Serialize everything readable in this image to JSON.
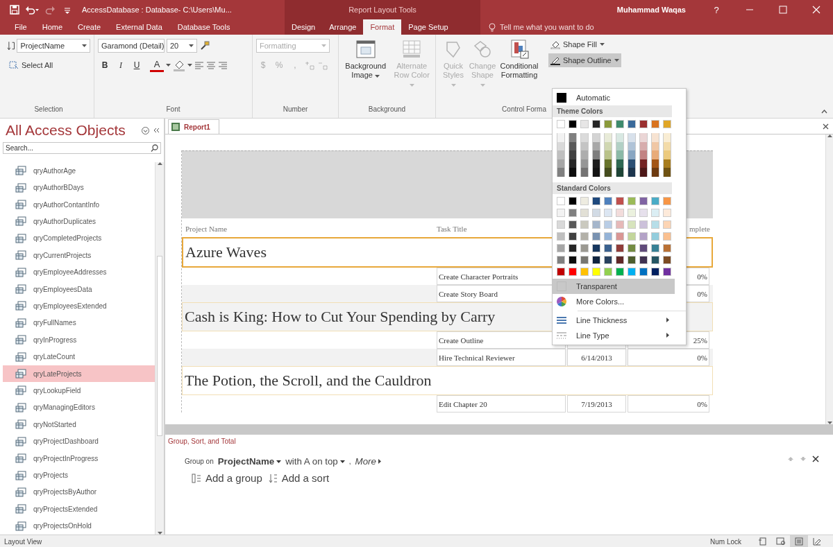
{
  "window": {
    "title": "AccessDatabase : Database- C:\\Users\\Mu...",
    "context_label": "Report Layout Tools",
    "user": "Muhammad Waqas",
    "help": "?"
  },
  "tabs": [
    {
      "label": "File",
      "selected": false,
      "contextual": false
    },
    {
      "label": "Home",
      "selected": false,
      "contextual": false
    },
    {
      "label": "Create",
      "selected": false,
      "contextual": false
    },
    {
      "label": "External Data",
      "selected": false,
      "contextual": false
    },
    {
      "label": "Database Tools",
      "selected": false,
      "contextual": false
    },
    {
      "label": "Design",
      "selected": false,
      "contextual": true
    },
    {
      "label": "Arrange",
      "selected": false,
      "contextual": true
    },
    {
      "label": "Format",
      "selected": true,
      "contextual": true
    },
    {
      "label": "Page Setup",
      "selected": false,
      "contextual": true
    }
  ],
  "tell_me": "Tell me what you want to do",
  "ribbon": {
    "selection": {
      "label": "Selection",
      "field": "ProjectName",
      "select_all": "Select All"
    },
    "font": {
      "label": "Font",
      "family": "Garamond (Detail)",
      "size": "20",
      "styles": [
        {
          "kind": "bold",
          "label": "B"
        },
        {
          "kind": "italic",
          "label": "I"
        },
        {
          "kind": "underline",
          "label": "U"
        }
      ],
      "font_color": "A"
    },
    "number": {
      "label": "Number",
      "format": {
        "value": "Formatting",
        "disabled": true
      },
      "symbols": [
        {
          "label": "$",
          "disabled": true
        },
        {
          "label": "%",
          "disabled": true
        },
        {
          "label": ",",
          "disabled": true
        }
      ]
    },
    "background": {
      "label": "Background",
      "buttons": [
        {
          "kind": "image",
          "label": "Background Image",
          "disabled": false
        },
        {
          "kind": "rows",
          "label": "Alternate Row Color",
          "disabled": true
        }
      ]
    },
    "control_formatting": {
      "label": "Control Forma",
      "buttons": [
        {
          "kind": "styles",
          "label": "Quick Styles",
          "disabled": true
        },
        {
          "kind": "shape",
          "label": "Change Shape",
          "disabled": true
        },
        {
          "kind": "conditional",
          "label": "Conditional Formatting",
          "disabled": false
        }
      ],
      "small_buttons": [
        {
          "kind": "fill",
          "label": "Shape Fill",
          "selected": false
        },
        {
          "kind": "outline",
          "label": "Shape Outline",
          "selected": true
        }
      ]
    }
  },
  "nav": {
    "title": "All Access Objects",
    "search_placeholder": "Search...",
    "items": [
      {
        "label": "qryAuthorAge",
        "selected": false
      },
      {
        "label": "qryAuthorBDays",
        "selected": false
      },
      {
        "label": "qryAuthorContantInfo",
        "selected": false
      },
      {
        "label": "qryAuthorDuplicates",
        "selected": false
      },
      {
        "label": "qryCompletedProjects",
        "selected": false
      },
      {
        "label": "qryCurrentProjects",
        "selected": false
      },
      {
        "label": "qryEmployeeAddresses",
        "selected": false
      },
      {
        "label": "qryEmployeesData",
        "selected": false
      },
      {
        "label": "qryEmployeesExtended",
        "selected": false
      },
      {
        "label": "qryFullNames",
        "selected": false
      },
      {
        "label": "qryInProgress",
        "selected": false
      },
      {
        "label": "qryLateCount",
        "selected": false
      },
      {
        "label": "qryLateProjects",
        "selected": true
      },
      {
        "label": "qryLookupField",
        "selected": false
      },
      {
        "label": "qryManagingEditors",
        "selected": false
      },
      {
        "label": "qryNotStarted",
        "selected": false
      },
      {
        "label": "qryProjectDashboard",
        "selected": false
      },
      {
        "label": "qryProjectInProgress",
        "selected": false
      },
      {
        "label": "qryProjects",
        "selected": false
      },
      {
        "label": "qryProjectsByAuthor",
        "selected": false
      },
      {
        "label": "qryProjectsExtended",
        "selected": false
      },
      {
        "label": "qryProjectsOnHold",
        "selected": false
      }
    ]
  },
  "document_tab": "Report1",
  "report": {
    "columns": [
      "Project Name",
      "Task Title",
      "mplete"
    ],
    "groups": [
      {
        "name": "Azure Waves",
        "selected": true,
        "shaded": false,
        "tasks": [
          {
            "title": "Create Character Portraits",
            "percent": "0%",
            "shaded": false
          },
          {
            "title": "Create Story Board",
            "percent": "0%",
            "shaded": true
          }
        ]
      },
      {
        "name": "Cash is King: How to Cut Your Spending by Carry",
        "selected": false,
        "shaded": true,
        "tasks": [
          {
            "title": "Create Outline",
            "percent": "25%",
            "shaded": false
          },
          {
            "title": "Hire Technical Reviewer",
            "date": "6/14/2013",
            "percent": "0%",
            "shaded": true
          }
        ]
      },
      {
        "name": "The Potion, the Scroll, and the Cauldron",
        "selected": false,
        "shaded": false,
        "tasks": [
          {
            "title": "Edit Chapter 20",
            "date": "7/19/2013",
            "percent": "0%",
            "shaded": false
          }
        ]
      }
    ]
  },
  "group_sort": {
    "title": "Group, Sort, and Total",
    "group_on": "Group on",
    "field": "ProjectName",
    "order": "with A on top",
    "separator": ",",
    "more": "More",
    "add_group": "Add a group",
    "add_sort": "Add a sort"
  },
  "outline_menu": {
    "automatic": "Automatic",
    "theme_header": "Theme Colors",
    "standard_header": "Standard Colors",
    "theme": [
      {
        "color": "#ffffff"
      },
      {
        "color": "#000000"
      },
      {
        "color": "#e7e6e6"
      },
      {
        "color": "#262626"
      },
      {
        "color": "#8a9a3b"
      },
      {
        "color": "#3e8a6d"
      },
      {
        "color": "#3a6a9a"
      },
      {
        "color": "#9a3030"
      },
      {
        "color": "#d9731f"
      },
      {
        "color": "#e0a626"
      }
    ],
    "standard": [
      {
        "color": "#ffffff"
      },
      {
        "color": "#000000"
      },
      {
        "color": "#eeece1"
      },
      {
        "color": "#1f497d"
      },
      {
        "color": "#4f81bd"
      },
      {
        "color": "#c0504d"
      },
      {
        "color": "#9bbb59"
      },
      {
        "color": "#8064a2"
      },
      {
        "color": "#4bacc6"
      },
      {
        "color": "#f79646"
      }
    ],
    "standard_row": [
      {
        "color": "#c00000"
      },
      {
        "color": "#ff0000"
      },
      {
        "color": "#ffc000"
      },
      {
        "color": "#ffff00"
      },
      {
        "color": "#92d050"
      },
      {
        "color": "#00b050"
      },
      {
        "color": "#00b0f0"
      },
      {
        "color": "#0070c0"
      },
      {
        "color": "#002060"
      },
      {
        "color": "#7030a0"
      }
    ],
    "items": [
      {
        "kind": "transparent",
        "label": "Transparent",
        "selected": true
      },
      {
        "kind": "more",
        "label": "More Colors...",
        "selected": false
      },
      {
        "kind": "thickness",
        "label": "Line Thickness",
        "selected": false
      },
      {
        "kind": "type",
        "label": "Line Type",
        "selected": false
      }
    ]
  },
  "status_bar": {
    "text": "Layout View",
    "num_lock": "Num Lock",
    "views": [
      {
        "kind": "report",
        "selected": false
      },
      {
        "kind": "print",
        "selected": false
      },
      {
        "kind": "layout",
        "selected": true
      },
      {
        "kind": "design",
        "selected": false
      }
    ]
  }
}
